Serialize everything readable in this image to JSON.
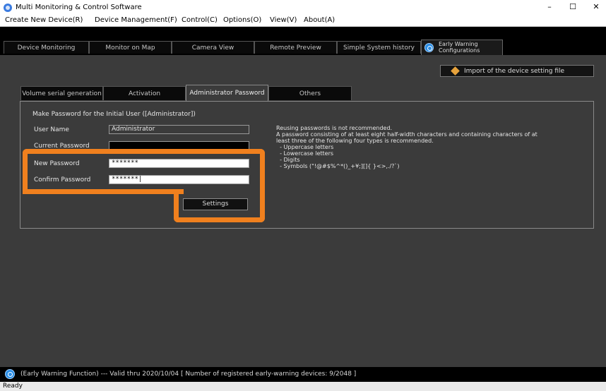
{
  "window": {
    "title": "Multi Monitoring & Control Software",
    "minimize": "–",
    "maximize": "☐",
    "close": "✕"
  },
  "menu": [
    "Create New Device(R)",
    "Device Management(F)",
    "Control(C)",
    "Options(O)",
    "View(V)",
    "About(A)"
  ],
  "main_tabs": [
    "Device Monitoring",
    "Monitor on Map",
    "Camera View",
    "Remote Preview",
    "Simple System history"
  ],
  "ew_tab": {
    "label": "Early Warning Configurations",
    "icon": "early-warning-icon"
  },
  "import_button": {
    "label": "Import of the device setting file",
    "icon": "import-icon"
  },
  "sub_tabs": [
    "Volume serial generation",
    "Activation",
    "Administrator Password",
    "Others"
  ],
  "sub_tab_active": "Administrator Password",
  "form": {
    "title": "Make Password for the Initial User ([Administrator])",
    "user_name_label": "User Name",
    "user_name_value": "Administrator",
    "current_password_label": "Current Password",
    "current_password_value": "",
    "new_password_label": "New Password",
    "new_password_value": "*******",
    "confirm_password_label": "Confirm Password",
    "confirm_password_value": "*******|",
    "settings_button": "Settings"
  },
  "notes": [
    "Reusing passwords is not recommended.",
    "A password consisting of at least eight half-width characters and containing characters of at",
    "least three of the following four types is recommended.",
    "  - Uppercase letters",
    "  - Lowercase letters",
    "  - Digits",
    "  - Symbols (\"!@#$%^*()_+¥;][]{ }<>,./?`)"
  ],
  "highlight_color": "#f0801e",
  "status": {
    "text": "(Early Warning Function) --- Valid thru 2020/10/04  [ Number of registered early-warning devices: 9/2048 ]",
    "ready": "Ready"
  }
}
